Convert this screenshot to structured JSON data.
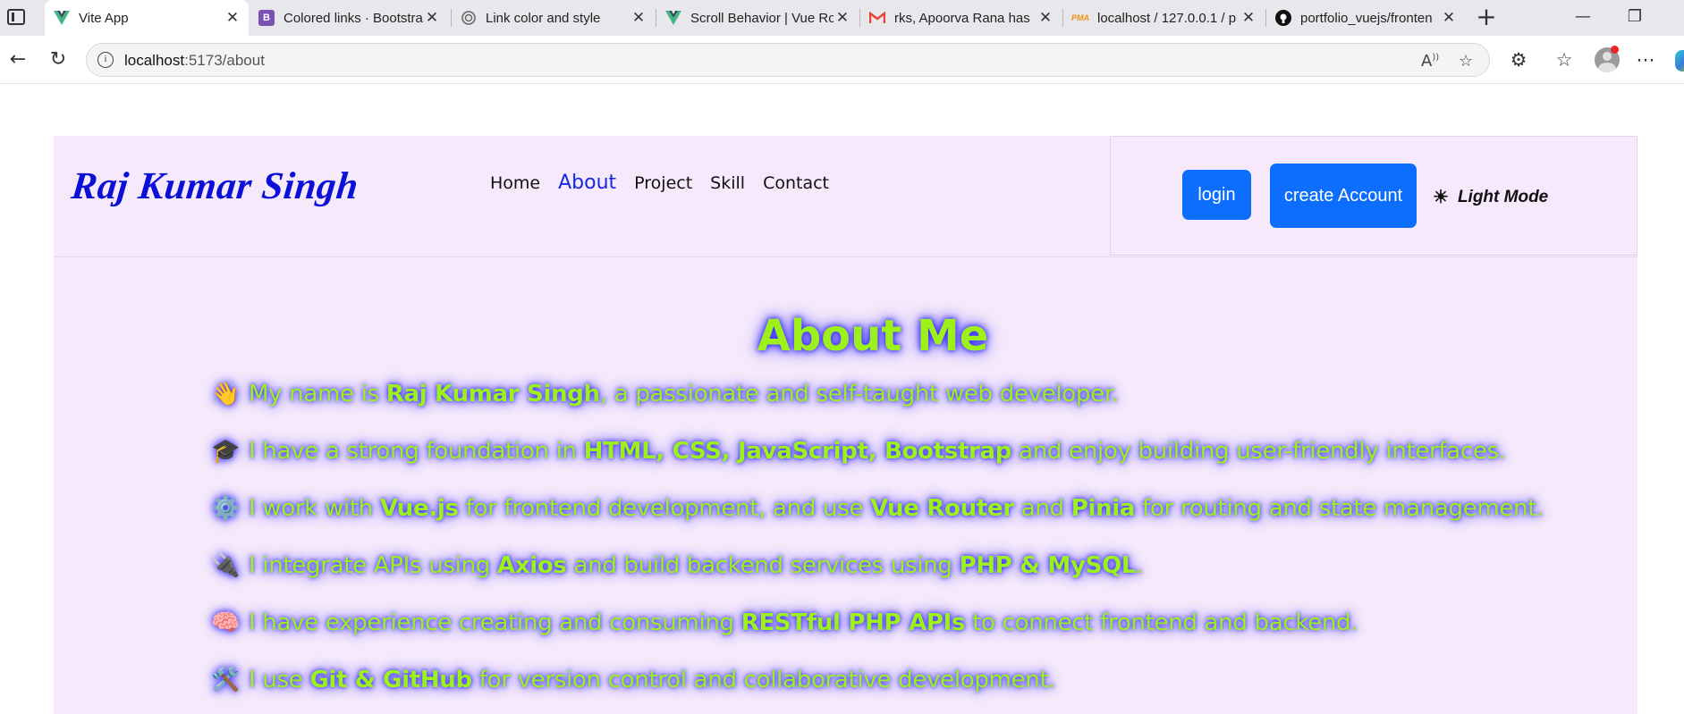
{
  "browser": {
    "tabs": [
      {
        "title": "Vite App",
        "favicon": "vue-icon",
        "active": true
      },
      {
        "title": "Colored links · Bootstra",
        "favicon": "bootstrap-icon",
        "active": false
      },
      {
        "title": "Link color and style",
        "favicon": "globe-icon",
        "active": false
      },
      {
        "title": "Scroll Behavior | Vue Ro",
        "favicon": "vue-icon",
        "active": false
      },
      {
        "title": "rks, Apoorva Rana has",
        "favicon": "gmail-icon",
        "active": false
      },
      {
        "title": "localhost / 127.0.0.1 / p",
        "favicon": "phpmyadmin-icon",
        "active": false
      },
      {
        "title": "portfolio_vuejs/fronten",
        "favicon": "github-icon",
        "active": false
      }
    ],
    "url_host": "localhost",
    "url_path": ":5173/about",
    "colors": {
      "accent": "#0d6efd",
      "brand": "#0a10d8",
      "nav_active": "#1229e6",
      "page_bg": "#f5e9fb",
      "glow_text": "#9ef01a",
      "glow_shadow": "#2d22ff"
    }
  },
  "header": {
    "brand": "Raj Kumar Singh",
    "nav": [
      "Home",
      "About",
      "Project",
      "Skill",
      "Contact"
    ],
    "nav_active": "About",
    "login_label": "login",
    "create_account_label": "create Account",
    "mode_icon": "sun-icon",
    "mode_label": "Light Mode"
  },
  "about": {
    "title": "About Me",
    "lines": [
      {
        "emoji": "👋",
        "icon": "waving-hand-icon",
        "p1": " My name is ",
        "b1": "Raj Kumar Singh",
        "p2": ", a passionate and self-taught web developer.",
        "b2": "",
        "p3": "",
        "b3": "",
        "p4": ""
      },
      {
        "emoji": "🎓",
        "icon": "graduation-cap-icon",
        "p1": " I have a strong foundation in ",
        "b1": "HTML, CSS, JavaScript, Bootstrap",
        "p2": " and enjoy building user-friendly interfaces.",
        "b2": "",
        "p3": "",
        "b3": "",
        "p4": ""
      },
      {
        "emoji": "⚙️",
        "icon": "gear-icon",
        "p1": " I work with ",
        "b1": "Vue.js",
        "p2": " for frontend development, and use ",
        "b2": "Vue Router",
        "p3": " and ",
        "b3": "Pinia",
        "p4": " for routing and state management."
      },
      {
        "emoji": "🔌",
        "icon": "plug-icon",
        "p1": " I integrate APIs using ",
        "b1": "Axios",
        "p2": " and build backend services using ",
        "b2": "PHP & MySQL",
        "p3": ".",
        "b3": "",
        "p4": ""
      },
      {
        "emoji": "🧠",
        "icon": "brain-icon",
        "p1": " I have experience creating and consuming ",
        "b1": "RESTful PHP APIs",
        "p2": " to connect frontend and backend.",
        "b2": "",
        "p3": "",
        "b3": "",
        "p4": ""
      },
      {
        "emoji": "🛠️",
        "icon": "tools-icon",
        "p1": " I use ",
        "b1": "Git & GitHub",
        "p2": " for version control and collaborative development.",
        "b2": "",
        "p3": "",
        "b3": "",
        "p4": ""
      }
    ]
  }
}
